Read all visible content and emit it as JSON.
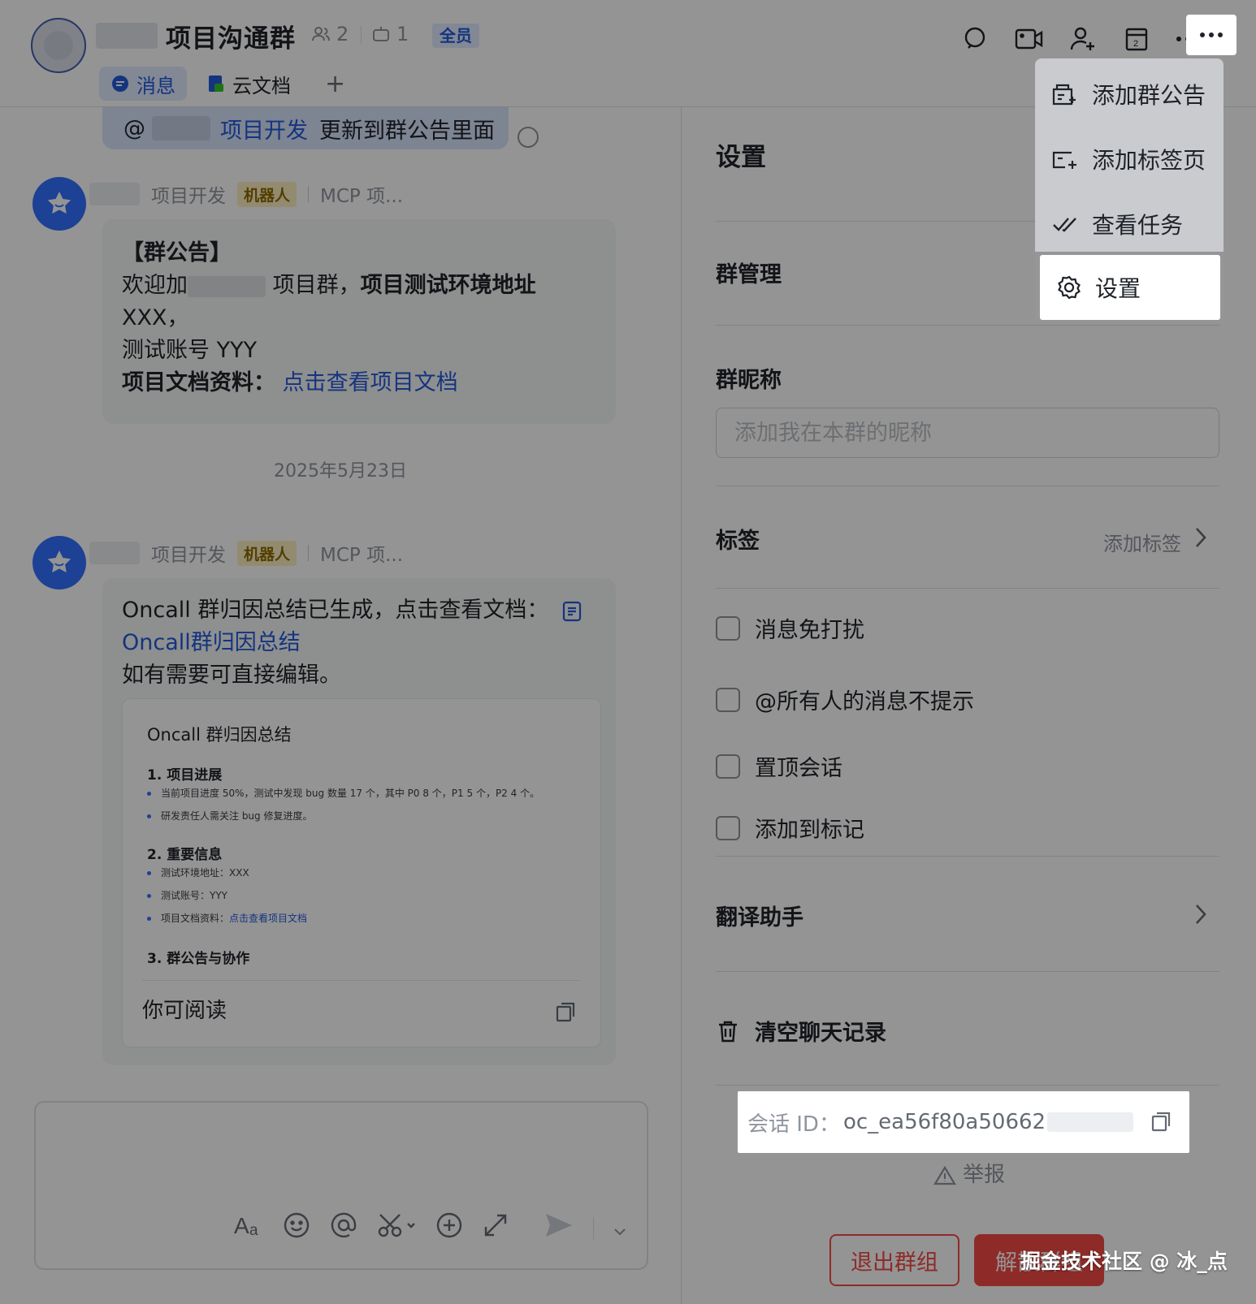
{
  "header": {
    "group_name": "项目沟通群",
    "member_count": "2",
    "bot_count": "1",
    "badge_all": "全员",
    "tabs": [
      {
        "label": "消息",
        "active": true
      },
      {
        "label": "云文档",
        "active": false
      }
    ],
    "add_tab": "+"
  },
  "dropdown": {
    "items": [
      {
        "label": "添加群公告",
        "icon": "announcement-icon"
      },
      {
        "label": "添加标签页",
        "icon": "tab-add-icon"
      },
      {
        "label": "查看任务",
        "icon": "task-check-icon"
      },
      {
        "label": "设置",
        "icon": "gear-icon"
      }
    ],
    "active_index": 3
  },
  "chat": {
    "pinned": {
      "prefix": "@",
      "link": "项目开发",
      "text": "更新到群公告里面"
    },
    "messages": [
      {
        "sender": "项目开发",
        "tag": "机器人",
        "source": "MCP 项...",
        "lines": {
          "title": "【群公告】",
          "l1_a": "欢迎加",
          "l1_b": "项目群，",
          "l1_bold": "项目测试环境地址",
          "l2": "XXX，",
          "l3": "测试账号 YYY",
          "l4_bold": "项目文档资料：",
          "l4_link": "点击查看项目文档"
        }
      },
      {
        "sender": "项目开发",
        "tag": "机器人",
        "source": "MCP 项...",
        "text_a": "Oncall 群归因总结已生成，点击查看文档：",
        "link": "Oncall群归因总结",
        "text_b": "如有需要可直接编辑。",
        "card": {
          "title": "Oncall 群归因总结",
          "s1": "1. 项目进展",
          "s1_b1": "当前项目进度 50%，测试中发现 bug 数量 17 个，其中 P0 8 个，P1 5 个，P2 4 个。",
          "s1_b2": "研发责任人需关注 bug 修复进度。",
          "s2": "2. 重要信息",
          "s2_b1": "测试环境地址：XXX",
          "s2_b2": "测试账号：YYY",
          "s2_b3_a": "项目文档资料：",
          "s2_b3_link": "点击查看项目文档",
          "s3": "3. 群公告与协作",
          "footer": "你可阅读"
        }
      }
    ],
    "date_separator": "2025年5月23日"
  },
  "settings": {
    "title": "设置",
    "group_manage": "群管理",
    "nickname_label": "群昵称",
    "nickname_placeholder": "添加我在本群的昵称",
    "tags_label": "标签",
    "tags_add": "添加标签",
    "options": [
      {
        "label": "消息免打扰",
        "checked": false
      },
      {
        "label": "@所有人的消息不提示",
        "checked": false
      },
      {
        "label": "置顶会话",
        "checked": false
      },
      {
        "label": "添加到标记",
        "checked": false
      }
    ],
    "translate": "翻译助手",
    "clear_history": "清空聊天记录",
    "conversation_id_label": "会话 ID：",
    "conversation_id_value": "oc_ea56f80a50662",
    "report": "举报",
    "leave_button": "退出群组",
    "dissolve_button": "解散群组"
  },
  "watermark": "掘金技术社区 @ 冰_点",
  "colors": {
    "accent": "#245bdb",
    "danger": "#f54a45",
    "bot_avatar": "#3370ff"
  }
}
